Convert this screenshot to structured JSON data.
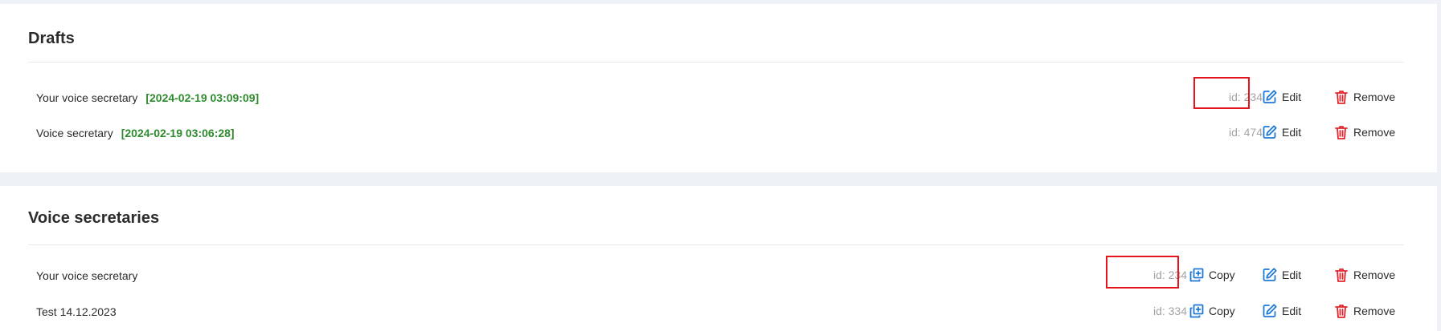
{
  "drafts": {
    "title": "Drafts",
    "rows": [
      {
        "title": "Your voice secretary",
        "date": "[2024-02-19 03:09:09]",
        "id": "id: 234",
        "edit": "Edit",
        "remove": "Remove"
      },
      {
        "title": "Voice secretary",
        "date": "[2024-02-19 03:06:28]",
        "id": "id: 474",
        "edit": "Edit",
        "remove": "Remove"
      }
    ]
  },
  "voice_secretaries": {
    "title": "Voice secretaries",
    "rows": [
      {
        "title": "Your voice secretary",
        "id": "id: 234",
        "copy": "Copy",
        "edit": "Edit",
        "remove": "Remove"
      },
      {
        "title": "Test 14.12.2023",
        "id": "id: 334",
        "copy": "Copy",
        "edit": "Edit",
        "remove": "Remove"
      }
    ]
  },
  "colors": {
    "accent_blue": "#1e7ad6",
    "remove_red": "#e0262d",
    "date_green": "#2e8b2e",
    "highlight_red": "#e8141c"
  }
}
